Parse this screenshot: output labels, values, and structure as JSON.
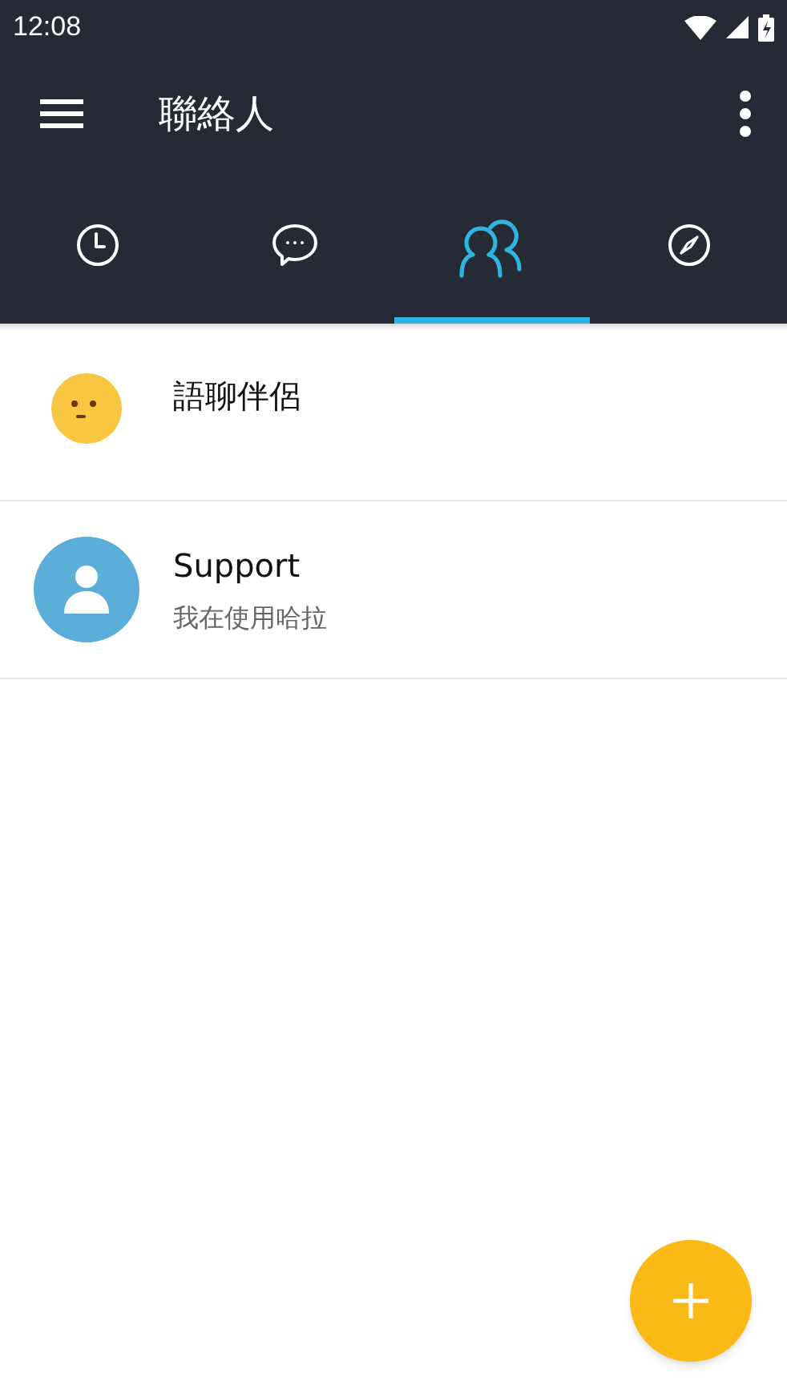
{
  "status_bar": {
    "time": "12:08"
  },
  "toolbar": {
    "title": "聯絡人"
  },
  "tabs": [
    {
      "selected": false
    },
    {
      "selected": false
    },
    {
      "selected": true
    },
    {
      "selected": false
    }
  ],
  "contacts": [
    {
      "kind": "emoji",
      "name": "語聊伴侶"
    },
    {
      "kind": "person",
      "name": "Support",
      "status": "我在使用哈拉"
    }
  ]
}
